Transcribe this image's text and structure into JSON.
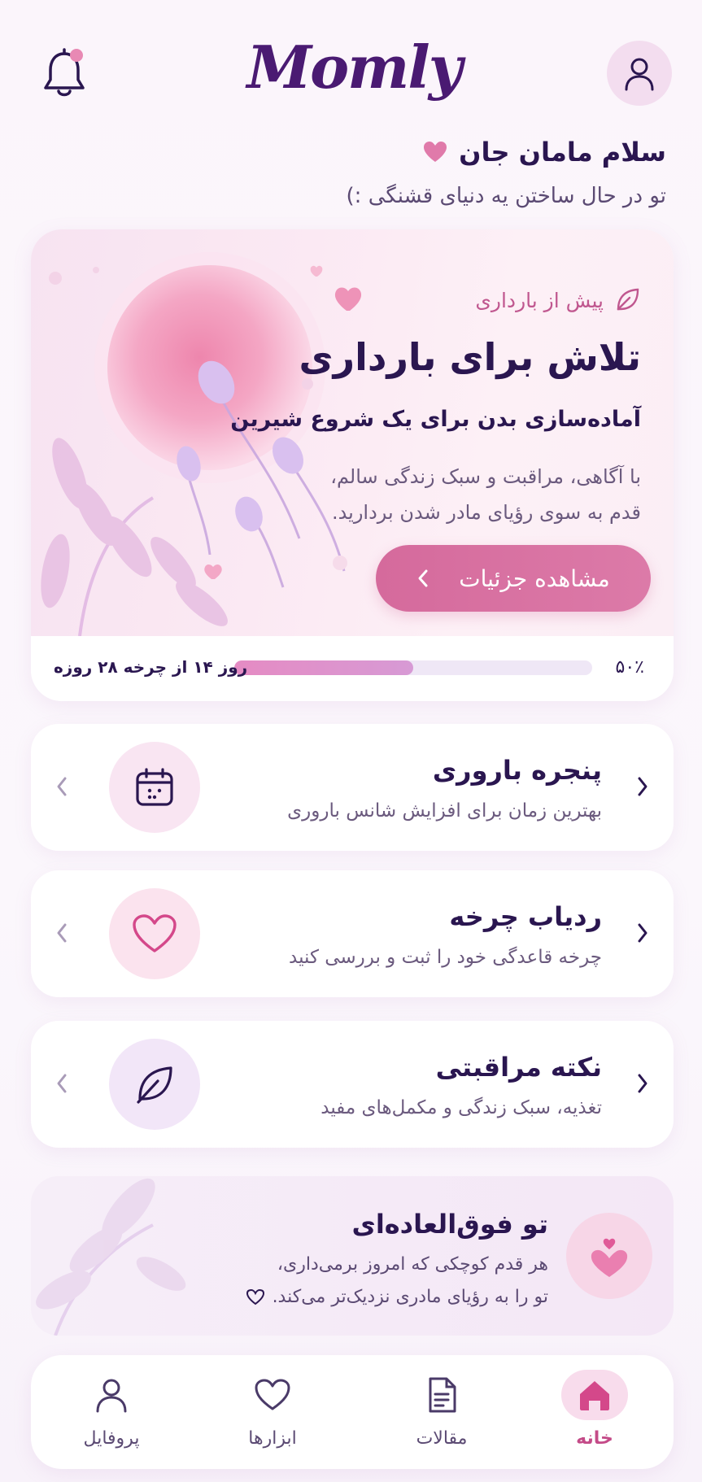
{
  "header": {
    "logo": "Momly",
    "bell_icon": "bell-icon",
    "profile_icon": "user-icon"
  },
  "greeting": {
    "title": "سلام مامان جان",
    "subtitle": "تو در حال ساختن یه دنیای قشنگی :)"
  },
  "hero": {
    "tag": "پیش از بارداری",
    "title": "تلاش برای بارداری",
    "subtitle": "آماده‌سازی بدن برای یک شروع شیرین",
    "desc_line1": "با آگاهی، مراقبت و سبک زندگی سالم،",
    "desc_line2": "قدم به سوی رؤیای مادر شدن بردارید.",
    "button": "مشاهده جزئیات",
    "progress_percent_label": "۵۰٪",
    "progress_fraction": 0.5,
    "cycle_text": "روز ۱۴ از چرخه ۲۸ روزه"
  },
  "features": [
    {
      "title": "پنجره باروری",
      "desc": "بهترین زمان برای افزایش شانس باروری",
      "icon": "calendar-icon"
    },
    {
      "title": "ردیاب چرخه",
      "desc": "چرخه قاعدگی خود را ثبت و بررسی کنید",
      "icon": "heart-icon"
    },
    {
      "title": "نکته مراقبتی",
      "desc": "تغذیه، سبک زندگی و مکمل‌های مفید",
      "icon": "leaf-icon"
    }
  ],
  "encourage": {
    "title": "تو فوق‌العاده‌ای",
    "line1": "هر قدم کوچکی که امروز برمی‌داری،",
    "line2": "تو را به رؤیای مادری نزدیک‌تر می‌کند."
  },
  "nav": {
    "home": "خانه",
    "articles": "مقالات",
    "tools": "ابزارها",
    "profile": "پروفایل"
  },
  "colors": {
    "primary_text": "#2a1650",
    "accent_pink": "#d56a9c",
    "logo": "#4a1a72"
  }
}
